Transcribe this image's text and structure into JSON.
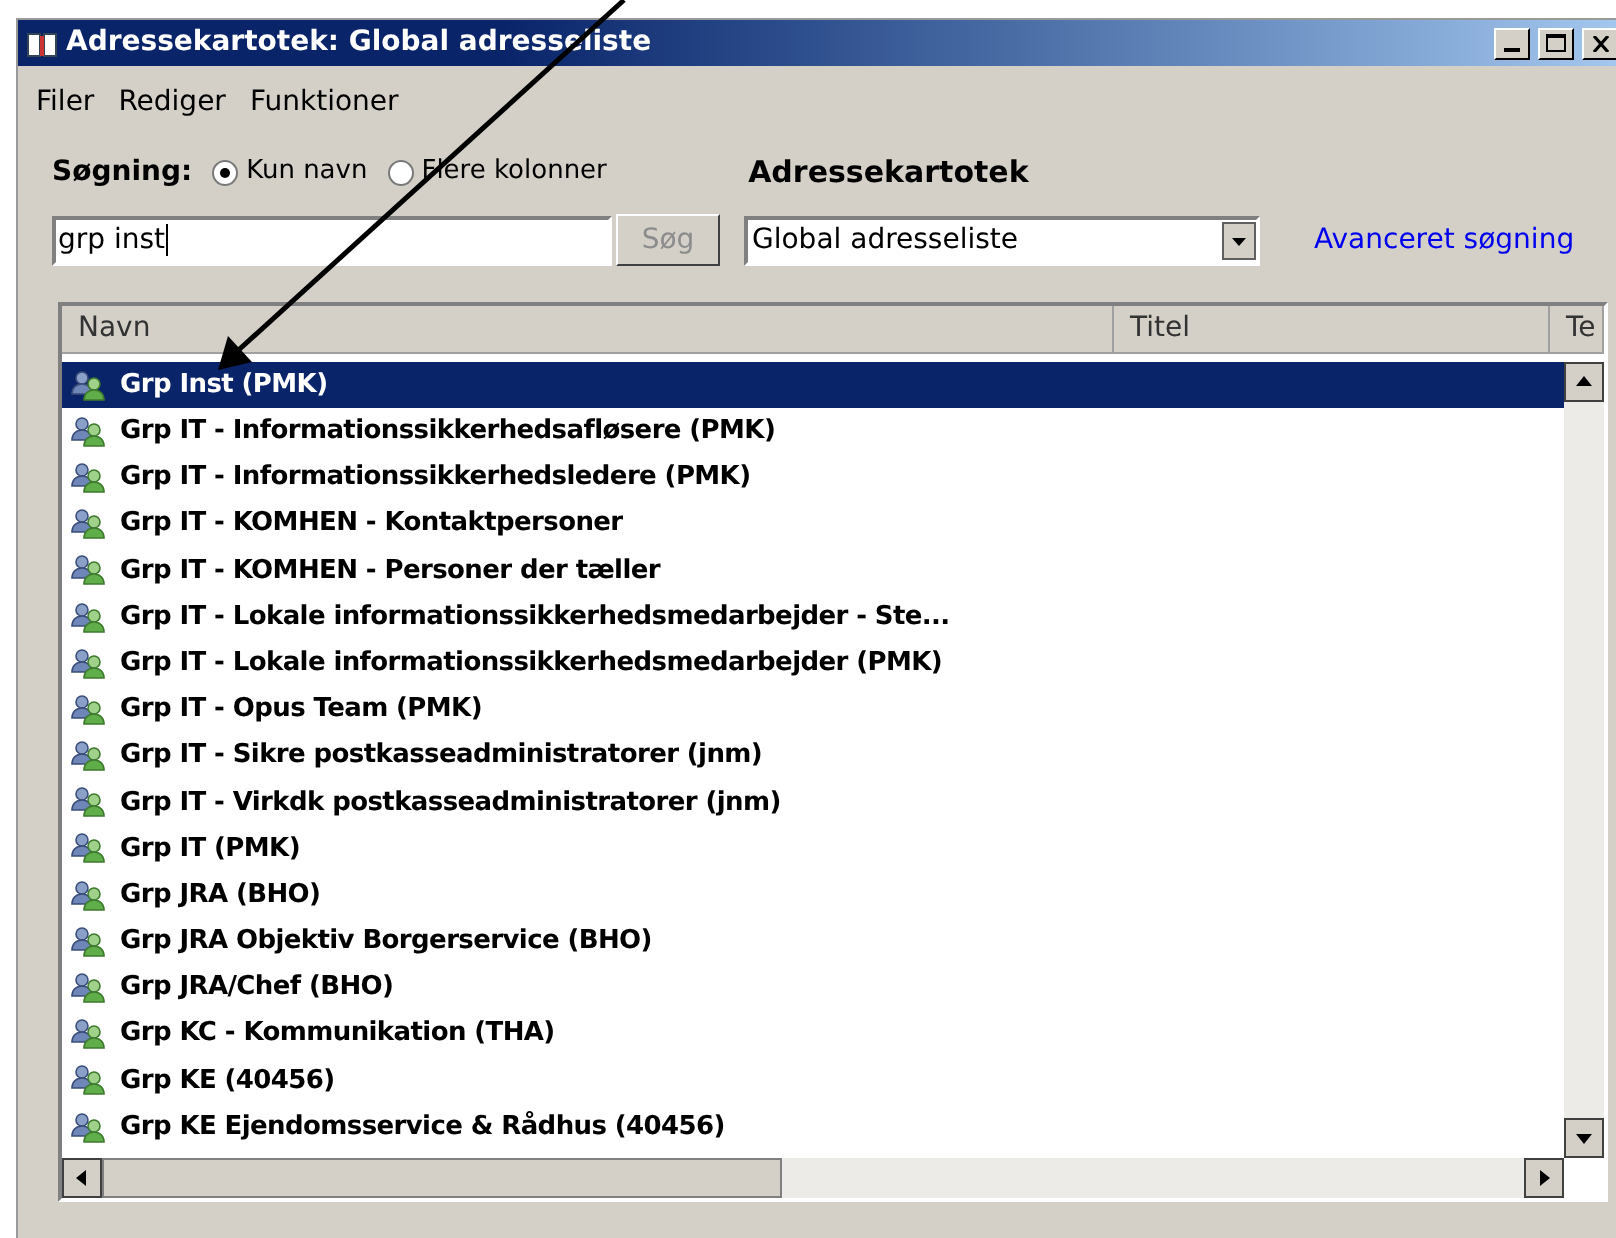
{
  "window": {
    "title": "Adressekartotek: Global adresseliste"
  },
  "menu": [
    "Filer",
    "Rediger",
    "Funktioner"
  ],
  "search": {
    "label": "Søgning:",
    "options": [
      {
        "label": "Kun navn",
        "selected": true
      },
      {
        "label": "Flere kolonner",
        "selected": false
      }
    ],
    "value": "grp inst",
    "button": "Søg",
    "button_disabled": true
  },
  "address_book": {
    "label": "Adressekartotek",
    "value": "Global adresseliste"
  },
  "advanced_link": "Avanceret søgning",
  "table": {
    "columns": [
      "Navn",
      "Titel",
      "Te"
    ],
    "rows": [
      {
        "name": "Grp Inst (PMK)",
        "selected": true
      },
      {
        "name": "Grp IT - Informationssikkerhedsafløsere (PMK)",
        "selected": false
      },
      {
        "name": "Grp IT - Informationssikkerhedsledere (PMK)",
        "selected": false
      },
      {
        "name": "Grp IT - KOMHEN - Kontaktpersoner",
        "selected": false
      },
      {
        "name": "Grp IT - KOMHEN - Personer der tæller",
        "selected": false
      },
      {
        "name": "Grp IT - Lokale informationssikkerhedsmedarbejder - Ste...",
        "selected": false
      },
      {
        "name": "Grp IT - Lokale informationssikkerhedsmedarbejder (PMK)",
        "selected": false
      },
      {
        "name": "Grp IT - Opus Team (PMK)",
        "selected": false
      },
      {
        "name": "Grp IT - Sikre postkasseadministratorer (jnm)",
        "selected": false
      },
      {
        "name": "Grp IT - Virkdk postkasseadministratorer (jnm)",
        "selected": false
      },
      {
        "name": "Grp IT (PMK)",
        "selected": false
      },
      {
        "name": "Grp JRA (BHO)",
        "selected": false
      },
      {
        "name": "Grp JRA Objektiv Borgerservice (BHO)",
        "selected": false
      },
      {
        "name": "Grp JRA/Chef (BHO)",
        "selected": false
      },
      {
        "name": "Grp KC - Kommunikation (THA)",
        "selected": false
      },
      {
        "name": "Grp KE (40456)",
        "selected": false
      },
      {
        "name": "Grp KE Ejendomsservice & Rådhus (40456)",
        "selected": false
      }
    ]
  }
}
